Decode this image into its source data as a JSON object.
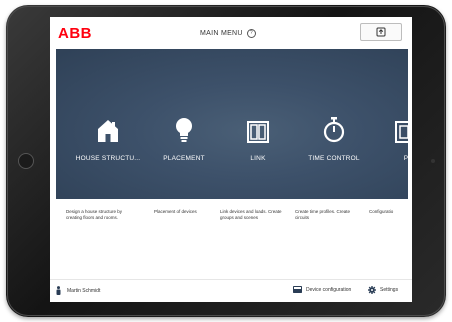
{
  "header": {
    "logo": "ABB",
    "title": "MAIN MENU",
    "help_glyph": "?"
  },
  "tiles": [
    {
      "label": "HOUSE STRUCTU...",
      "icon": "house-icon",
      "description": "Design a house structure by creating floors and rooms."
    },
    {
      "label": "PLACEMENT",
      "icon": "lightbulb-icon",
      "description": "Placement of devices"
    },
    {
      "label": "LINK",
      "icon": "link-panel-icon",
      "description": "Link devices and loads. Create groups and scenes"
    },
    {
      "label": "TIME CONTROL",
      "icon": "stopwatch-icon",
      "description": "Create time profiles. Create circuits"
    },
    {
      "label": "P",
      "icon": "device-icon",
      "description": "Configuratio"
    }
  ],
  "footer": {
    "user_name": "Martin Schmidt",
    "device_configuration": "Device configuration",
    "settings": "Settings"
  },
  "colors": {
    "brand": "#ff000f",
    "hero_background": "#3d516a"
  }
}
